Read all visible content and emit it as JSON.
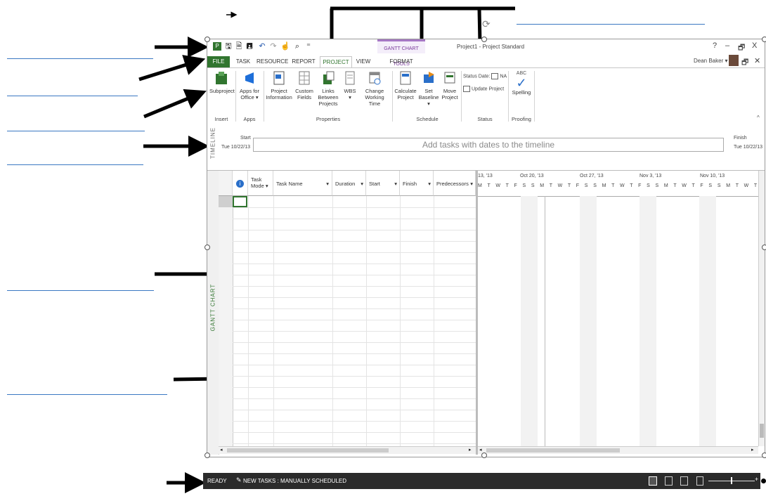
{
  "window": {
    "title": "Project1 - Project Standard",
    "contextual_tab_group": "GANTT CHART TOOLS",
    "help": "?",
    "minimize": "–",
    "restore": "🗗",
    "close": "X",
    "user_name": "Dean Baker ▾"
  },
  "tabs": [
    {
      "label": "FILE"
    },
    {
      "label": "TASK"
    },
    {
      "label": "RESOURCE"
    },
    {
      "label": "REPORT"
    },
    {
      "label": "PROJECT"
    },
    {
      "label": "VIEW"
    },
    {
      "label": "FORMAT"
    }
  ],
  "ribbon": {
    "buttons": {
      "subproject": "Subproject",
      "apps_for_office": "Apps for Office ▾",
      "project_information": "Project Information",
      "custom_fields": "Custom Fields",
      "links_between_projects": "Links Between Projects",
      "wbs": "WBS ▾",
      "change_working_time": "Change Working Time",
      "calculate_project": "Calculate Project",
      "set_baseline": "Set Baseline ▾",
      "move_project": "Move Project",
      "status_date_label": "Status Date:",
      "status_date_value": "NA",
      "update_project": "Update Project",
      "spelling": "Spelling",
      "spelling_abc": "ABC"
    },
    "groups": {
      "insert": "Insert",
      "apps": "Apps",
      "properties": "Properties",
      "schedule": "Schedule",
      "status": "Status",
      "proofing": "Proofing"
    }
  },
  "timeline": {
    "side_label": "TIMELINE",
    "start_label": "Start",
    "start_date": "Tue 10/22/13",
    "finish_label": "Finish",
    "finish_date": "Tue 10/22/13",
    "placeholder": "Add tasks with dates to the timeline"
  },
  "table": {
    "side_label": "GANTT CHART",
    "columns": [
      "Task Mode ▾",
      "Task Name",
      "Duration",
      "Start",
      "Finish",
      "Predecessors"
    ]
  },
  "gantt": {
    "weeks": [
      "13, '13",
      "Oct 20, '13",
      "Oct 27, '13",
      "Nov 3, '13",
      "Nov 10, '13"
    ],
    "day_letters": "M T W T F S S M T W T F S S M T W T F S S M T W T F S S M T W T F"
  },
  "status_bar": {
    "ready": "READY",
    "new_tasks": "NEW TASKS : MANUALLY SCHEDULED"
  },
  "colors": {
    "project_green": "#31752f",
    "contextual_purple": "#a678c4",
    "status_bar": "#2b2b2b",
    "annotation_line": "#3a78c2"
  }
}
